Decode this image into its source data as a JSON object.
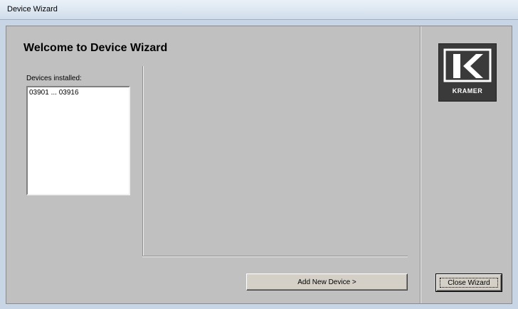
{
  "window": {
    "title": "Device Wizard"
  },
  "main": {
    "heading": "Welcome to Device Wizard",
    "devices_label": "Devices installed:",
    "devices": [
      "03901 ... 03916"
    ]
  },
  "logo": {
    "text": "KRAMER",
    "icon": "kramer-k-logo"
  },
  "buttons": {
    "add_new_device": "Add New Device >",
    "close_wizard": "Close Wizard"
  },
  "colors": {
    "client_bg": "#c0c0c0",
    "titlebar": "#dfe9f3",
    "logo_bg": "#3a3a3a"
  }
}
